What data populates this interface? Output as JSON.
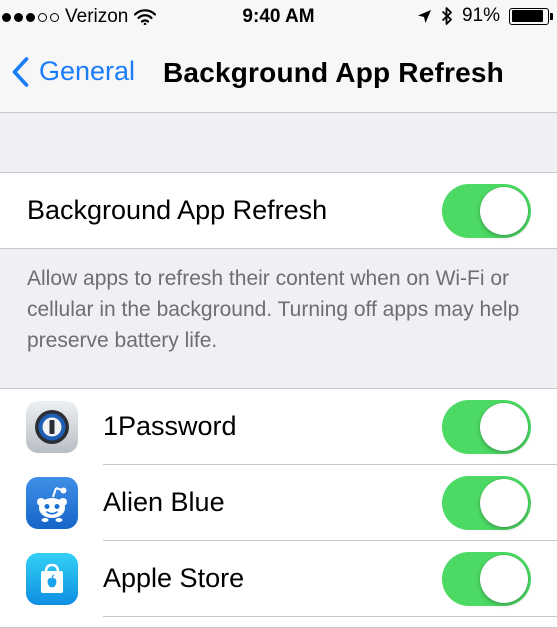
{
  "status_bar": {
    "carrier": "Verizon",
    "time": "9:40 AM",
    "battery_percent": "91%",
    "battery_level": 0.91,
    "signal_bars": 3,
    "signal_total": 5
  },
  "nav": {
    "back_label": "General",
    "title": "Background App Refresh"
  },
  "master": {
    "label": "Background App Refresh",
    "enabled": true
  },
  "footer": "Allow apps to refresh their content when on Wi-Fi or cellular in the background. Turning off apps may help preserve battery life.",
  "apps": [
    {
      "name": "1Password",
      "icon": "1password-icon",
      "enabled": true
    },
    {
      "name": "Alien Blue",
      "icon": "alien-blue-icon",
      "enabled": true
    },
    {
      "name": "Apple Store",
      "icon": "apple-store-icon",
      "enabled": true
    }
  ],
  "colors": {
    "accent": "#1a7dfb",
    "toggle_on": "#4cd964",
    "background": "#efeff4"
  }
}
